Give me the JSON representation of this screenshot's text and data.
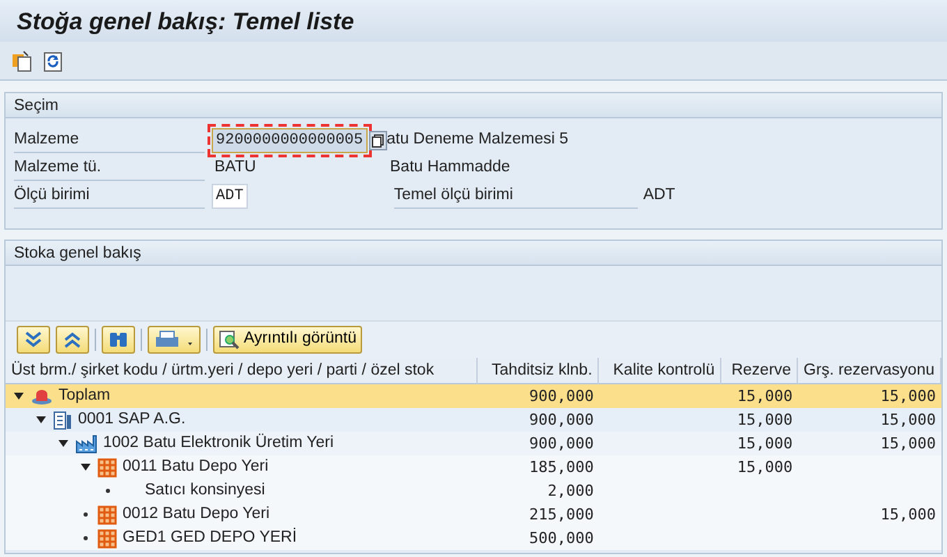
{
  "window": {
    "title": "Stoğa genel bakış: Temel liste"
  },
  "toolbar": [
    {
      "kind": "new"
    },
    {
      "kind": "refresh"
    }
  ],
  "selection": {
    "title": "Seçim",
    "material": {
      "label": "Malzeme",
      "value": "9200000000000005",
      "focused": true,
      "description": "atu Deneme Malzemesi 5"
    },
    "material_type": {
      "label": "Malzeme tü.",
      "value": "BATU",
      "description": "Batu Hammadde"
    },
    "unit": {
      "label": "Ölçü birimi",
      "value": "ADT",
      "base_label": "Temel ölçü birimi",
      "base_value": "ADT"
    }
  },
  "overview": {
    "title": "Stoka genel bakış",
    "tree_toolbar": [
      {
        "kind": "expand"
      },
      {
        "kind": "collapse"
      },
      {
        "kind": "find"
      },
      {
        "kind": "print"
      },
      {
        "kind": "detail",
        "label": "Ayrıntılı görüntü"
      }
    ],
    "columns": [
      "Üst brm./ şirket kodu / ürtm.yeri / depo yeri / parti / özel stok",
      "Tahditsiz klnb.",
      "Kalite kontrolü",
      "Rezerve",
      "Grş. rezervasyonu"
    ],
    "tree": [
      {
        "kind": "total",
        "label": "Toplam",
        "selected": true,
        "expanded": true,
        "cells": [
          "900,000",
          null,
          "15,000",
          "15,000"
        ],
        "children": [
          {
            "kind": "company",
            "label": "0001 SAP A.G.",
            "selected": false,
            "expanded": true,
            "cells": [
              "900,000",
              null,
              "15,000",
              "15,000"
            ],
            "children": [
              {
                "kind": "plant",
                "label": "1002 Batu Elektronik Üretim Yeri",
                "selected": false,
                "expanded": true,
                "cells": [
                  "900,000",
                  null,
                  "15,000",
                  "15,000"
                ],
                "children": [
                  {
                    "kind": "storage",
                    "label": "0011 Batu Depo Yeri",
                    "selected": false,
                    "expanded": true,
                    "cells": [
                      "185,000",
                      null,
                      "15,000",
                      null
                    ],
                    "children": [
                      {
                        "kind": "special",
                        "label": "Satıcı konsinyesi",
                        "selected": false,
                        "cells": [
                          "2,000",
                          null,
                          null,
                          null
                        ]
                      }
                    ]
                  },
                  {
                    "kind": "storage",
                    "label": "0012 Batu Depo Yeri",
                    "selected": false,
                    "cells": [
                      "215,000",
                      null,
                      null,
                      "15,000"
                    ]
                  },
                  {
                    "kind": "storage",
                    "label": "GED1 GED DEPO YERİ",
                    "selected": false,
                    "cells": [
                      "500,000",
                      null,
                      null,
                      null
                    ]
                  }
                ]
              }
            ]
          }
        ]
      }
    ]
  }
}
